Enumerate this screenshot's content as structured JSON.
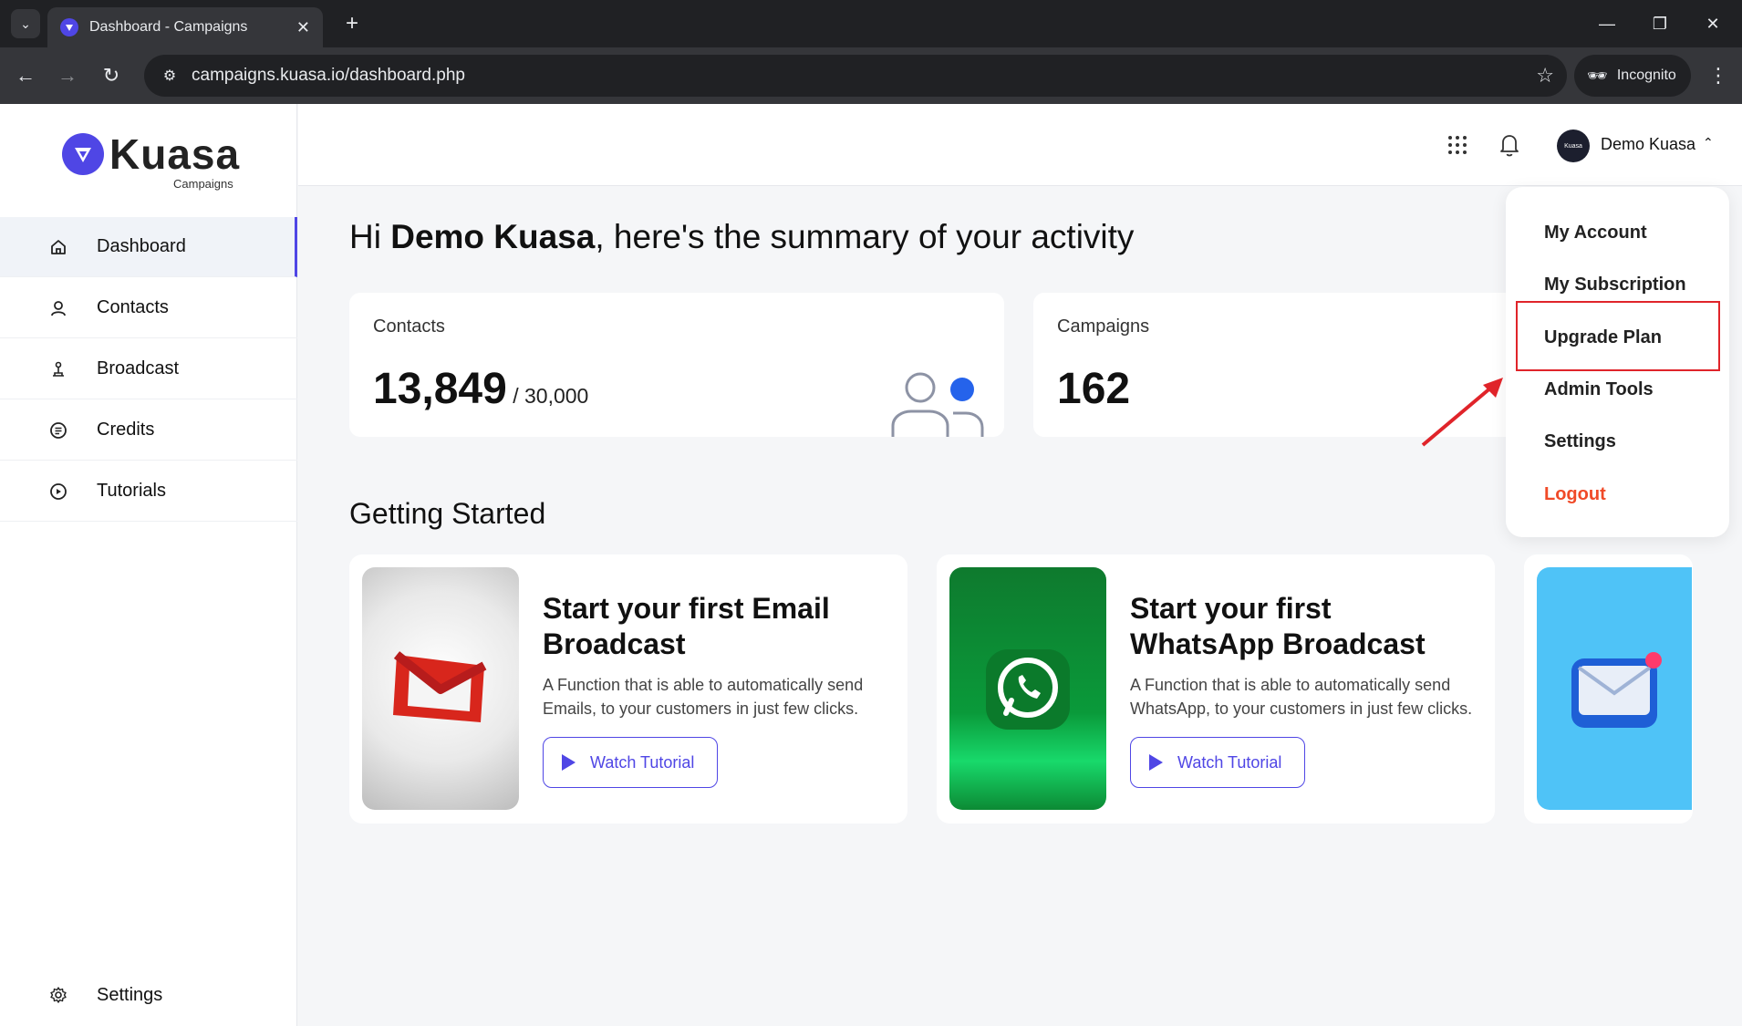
{
  "browser": {
    "tab_title": "Dashboard - Campaigns",
    "url": "campaigns.kuasa.io/dashboard.php",
    "incognito_label": "Incognito"
  },
  "brand": {
    "name": "Kuasa",
    "subtitle": "Campaigns",
    "accent_color": "#4f46e5"
  },
  "sidebar": {
    "items": [
      {
        "label": "Dashboard",
        "icon": "home-icon",
        "active": true
      },
      {
        "label": "Contacts",
        "icon": "user-icon"
      },
      {
        "label": "Broadcast",
        "icon": "broadcast-icon"
      },
      {
        "label": "Credits",
        "icon": "credits-icon"
      },
      {
        "label": "Tutorials",
        "icon": "play-circle-icon"
      }
    ],
    "footer_item": {
      "label": "Settings",
      "icon": "gear-icon"
    }
  },
  "header": {
    "user_name": "Demo Kuasa",
    "avatar_text": "Kuasa"
  },
  "greeting": {
    "prefix": "Hi ",
    "name": "Demo Kuasa",
    "suffix": ", here's the summary of your activity"
  },
  "stats": {
    "contacts": {
      "label": "Contacts",
      "value": "13,849",
      "total": " / 30,000"
    },
    "campaigns": {
      "label": "Campaigns",
      "value": "162"
    }
  },
  "getting_started": {
    "title": "Getting Started",
    "cards": [
      {
        "title": "Start your first Email Broadcast",
        "description": "A Function that is able to automatically send Emails, to your customers in just few clicks.",
        "button": "Watch Tutorial",
        "image_icon": "gmail-icon"
      },
      {
        "title": "Start your first WhatsApp Broadcast",
        "description": "A Function that is able to automatically send WhatsApp, to your customers in just few clicks.",
        "button": "Watch Tutorial",
        "image_icon": "whatsapp-icon"
      }
    ]
  },
  "user_menu": {
    "items": [
      "My Account",
      "My Subscription",
      "Upgrade Plan",
      "Admin Tools",
      "Settings"
    ],
    "logout": "Logout",
    "logout_color": "#f04a28",
    "highlight_color": "#e0242a"
  }
}
